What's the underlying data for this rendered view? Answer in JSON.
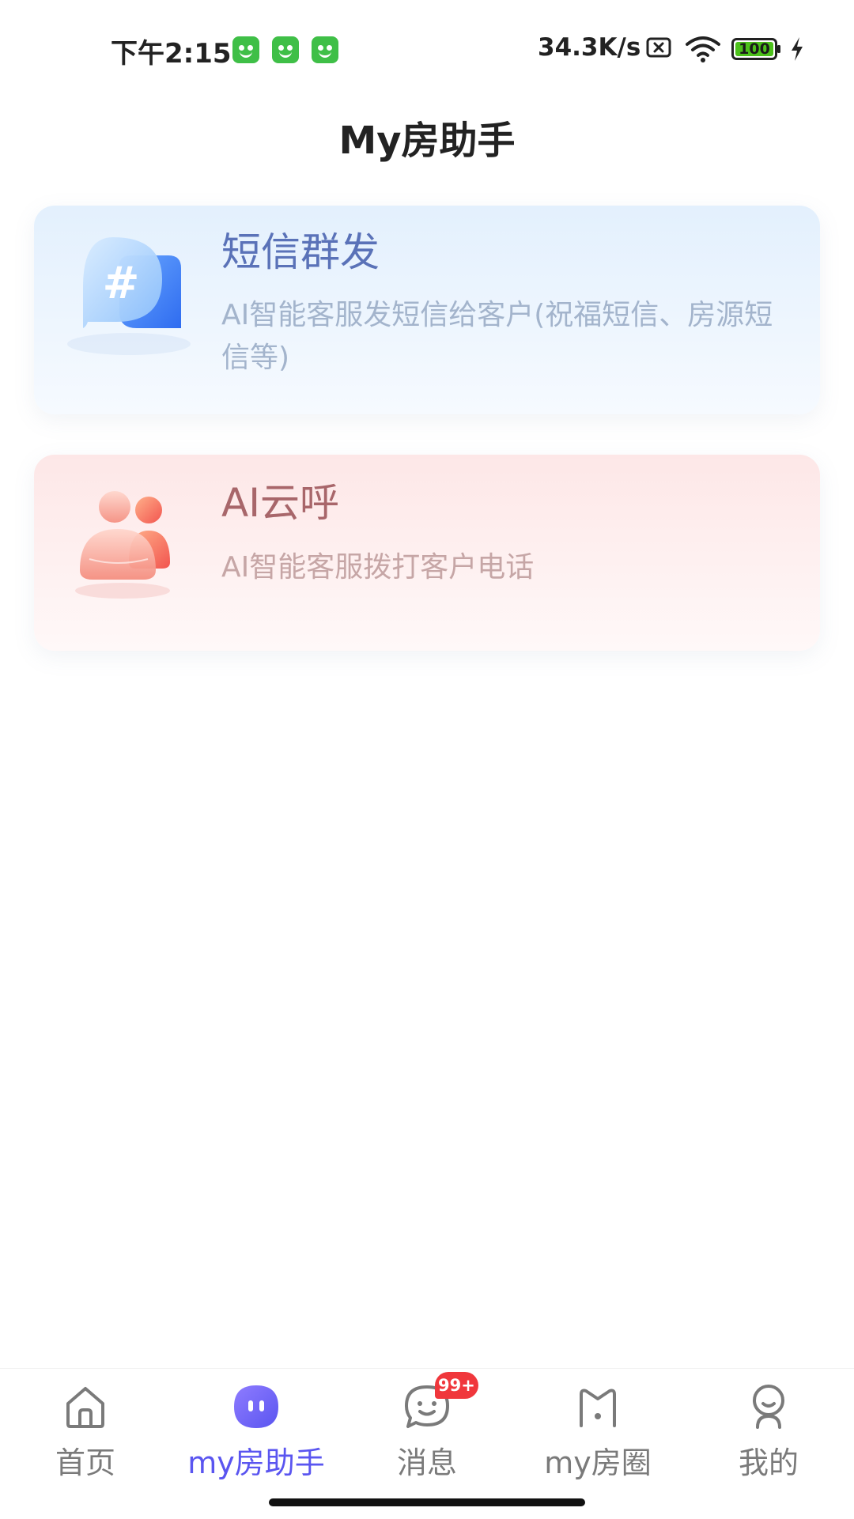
{
  "status_bar": {
    "time": "下午2:15",
    "app_icons": [
      "cat-app-icon",
      "cat-app-icon",
      "cat-app-icon"
    ],
    "network_speed": "34.3K/s",
    "sim_icon": "no-sim-icon",
    "wifi_icon": "wifi-icon",
    "battery_level": "100",
    "charging_icon": "lightning-icon",
    "app_icon_color": "#3fbf47",
    "battery_color": "#4cc11a"
  },
  "header": {
    "title": "My房助手"
  },
  "cards": [
    {
      "title": "短信群发",
      "description": "AI智能客服发短信给客户(祝福短信、房源短信等)",
      "icon": "hashtag-chat-bubble-icon",
      "title_color": "#5a72b8",
      "background_color": "#e3f0fd"
    },
    {
      "title": "AI云呼",
      "description": "AI智能客服拨打客户电话",
      "icon": "contacts-people-icon",
      "title_color": "#a8666a",
      "background_color": "#fde7e7"
    }
  ],
  "bottom_nav": {
    "active_color": "#5a55f0",
    "inactive_color": "#7a7a7a",
    "items": [
      {
        "label": "首页",
        "icon": "home-icon",
        "active": false
      },
      {
        "label": "my房助手",
        "icon": "assistant-robot-icon",
        "active": true
      },
      {
        "label": "消息",
        "icon": "message-icon",
        "active": false,
        "badge": "99+"
      },
      {
        "label": "my房圈",
        "icon": "circle-community-icon",
        "active": false
      },
      {
        "label": "我的",
        "icon": "profile-icon",
        "active": false
      }
    ]
  }
}
